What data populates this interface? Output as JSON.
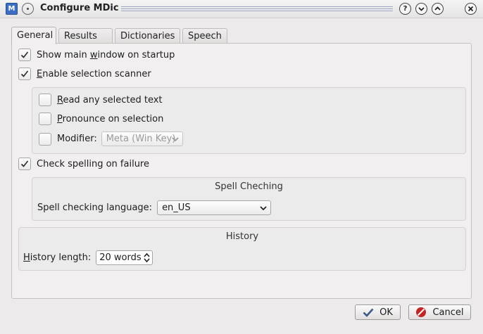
{
  "window": {
    "title": "Configure MDic",
    "app_icon_glyph": "M",
    "help_glyph": "?"
  },
  "tabs": [
    {
      "label": "General",
      "active": true
    },
    {
      "label": "Results",
      "active": false
    },
    {
      "label": "Dictionaries",
      "active": false
    },
    {
      "label": "Speech",
      "active": false
    }
  ],
  "general": {
    "show_main_window": {
      "label_pre": "Show main ",
      "label_acc": "w",
      "label_post": "indow on startup",
      "checked": true
    },
    "enable_scanner": {
      "label_pre": "",
      "label_acc": "E",
      "label_post": "nable selection scanner",
      "checked": true
    },
    "scanner_group": {
      "read_selected": {
        "label_pre": "",
        "label_acc": "R",
        "label_post": "ead any selected text",
        "checked": false
      },
      "pronounce": {
        "label_pre": "",
        "label_acc": "P",
        "label_post": "ronounce on selection",
        "checked": false
      },
      "modifier": {
        "label": "Modifier:",
        "checked": false,
        "value": "Meta (Win Key)"
      }
    },
    "check_spelling": {
      "label": "Check spelling on failure",
      "checked": true
    },
    "spell_group": {
      "title": "Spell Cheching",
      "language_label": "Spell checking language:",
      "language_value": "en_US"
    },
    "history_group": {
      "title": "History",
      "length_label_acc": "H",
      "length_label_post": "istory length:",
      "length_value": "20 words"
    }
  },
  "footer": {
    "ok_label": "OK",
    "cancel_label": "Cancel"
  },
  "colors": {
    "check_mark": "#2a2a2a",
    "ok_icon": "#3a5a8a",
    "cancel_icon": "#c42424"
  }
}
